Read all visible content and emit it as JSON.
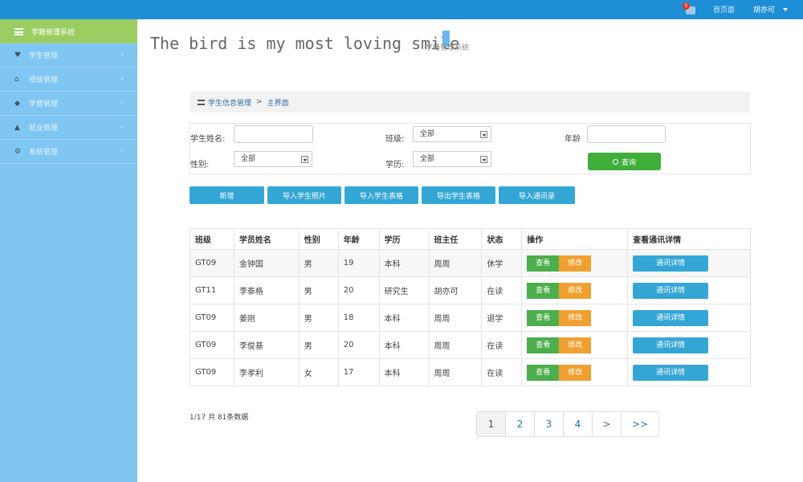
{
  "topbar": {
    "badge": "5",
    "link": "首页面",
    "user": "胡亦可"
  },
  "sidebar": {
    "title": "学籍管理系统",
    "items": [
      {
        "label": "学生管理",
        "icon": "heart-icon"
      },
      {
        "label": "班级管理",
        "icon": "home-icon"
      },
      {
        "label": "学费管理",
        "icon": "tag-icon"
      },
      {
        "label": "就业管理",
        "icon": "thumbs-up-icon"
      },
      {
        "label": "系统管理",
        "icon": "cogs-icon"
      }
    ]
  },
  "brand": {
    "slogan": "The bird is my most loving smile",
    "sub": "学籍管理系统"
  },
  "breadcrumb": {
    "first": "学生信息管理",
    "sep": ">",
    "current": "主界面"
  },
  "search": {
    "name_label": "学生姓名:",
    "name_value": "",
    "class_label": "班级:",
    "class_value": "全部",
    "age_label": "年龄",
    "age_value": "",
    "gender_label": "性别:",
    "gender_value": "全部",
    "edu_label": "学历:",
    "edu_value": "全部",
    "query_label": "查询"
  },
  "actions": [
    "新增",
    "导入学生照片",
    "导入学生表格",
    "导出学生表格",
    "导入通讯录"
  ],
  "table": {
    "headers": [
      "班级",
      "学员姓名",
      "性别",
      "年龄",
      "学历",
      "班主任",
      "状态",
      "操作",
      "查看通讯详情"
    ],
    "view_label": "查看",
    "edit_label": "修改",
    "detail_label": "通讯详情",
    "rows": [
      [
        "GT09",
        "金钟国",
        "男",
        "19",
        "本科",
        "周周",
        "休学"
      ],
      [
        "GT11",
        "李泰格",
        "男",
        "20",
        "研究生",
        "胡亦可",
        "在读"
      ],
      [
        "GT09",
        "姜刚",
        "男",
        "18",
        "本科",
        "周周",
        "退学"
      ],
      [
        "GT09",
        "李俊基",
        "男",
        "20",
        "本科",
        "周周",
        "在读"
      ],
      [
        "GT09",
        "李孝利",
        "女",
        "17",
        "本科",
        "周周",
        "在读"
      ]
    ]
  },
  "pagination": {
    "info": "1/17 共 81条数据",
    "pages": [
      "1",
      "2",
      "3",
      "4",
      ">",
      ">>"
    ]
  }
}
